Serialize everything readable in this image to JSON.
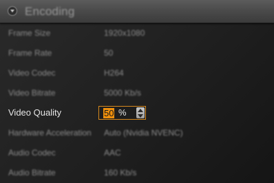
{
  "panel": {
    "title": "Encoding",
    "collapse_icon": "chevron-down-icon"
  },
  "rows": [
    {
      "label": "Frame Size",
      "value": "1920x1080"
    },
    {
      "label": "Frame Rate",
      "value": "50"
    },
    {
      "label": "Video Codec",
      "value": "H264"
    },
    {
      "label": "Video Bitrate",
      "value": "5000 Kb/s"
    },
    {
      "label": "Video Quality",
      "value": "50",
      "unit": "%"
    },
    {
      "label": "Hardware Acceleration",
      "value": "Auto (Nvidia NVENC)"
    },
    {
      "label": "Audio Codec",
      "value": "AAC"
    },
    {
      "label": "Audio Bitrate",
      "value": "160 Kb/s"
    }
  ],
  "colors": {
    "accent": "#ee8f0c",
    "focus_border": "#d88a1e",
    "background": "#1f1f1f"
  }
}
